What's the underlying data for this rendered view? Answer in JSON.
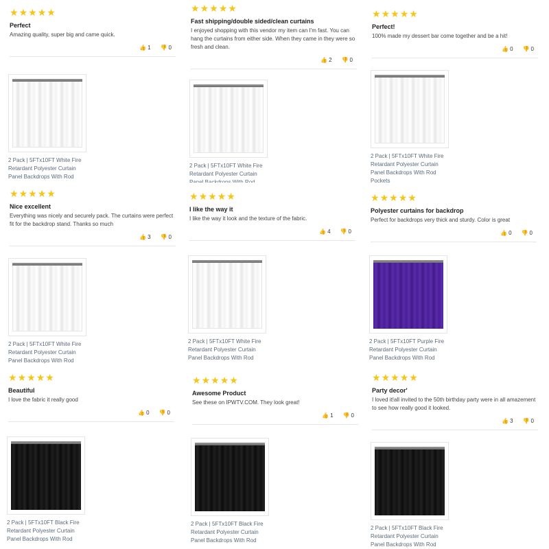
{
  "reviews": [
    {
      "title": "Perfect",
      "body": "Amazing quality, super big and came quick.",
      "up": "1",
      "down": "0",
      "product": {
        "color": "white",
        "name": "2 Pack | 5FTx10FT White Fire Retardant Polyester Curtain Panel Backdrops With Rod"
      }
    },
    {
      "title": "Fast shipping/double sided/clean curtains",
      "body": "I enjoyed shopping with this vendor my item can I'm fast. You can hang the curtains from either side. When they came in they were so fresh and clean.",
      "up": "2",
      "down": "0",
      "product": {
        "color": "white",
        "name": "2 Pack | 5FTx10FT White Fire Retardant Polyester Curtain Panel Backdrops With Rod"
      }
    },
    {
      "title": "Perfect!",
      "body": "100% made my dessert bar come together and be a hit!",
      "up": "0",
      "down": "0",
      "product": {
        "color": "white",
        "name": "2 Pack | 5FTx10FT White Fire Retardant Polyester Curtain Panel Backdrops With Rod Pockets"
      }
    },
    {
      "title": "Nice excellent",
      "body": "Everything was nicely and securely pack. The curtains were perfect fit for the backdrop stand. Thanks so much",
      "up": "3",
      "down": "0",
      "product": {
        "color": "white",
        "name": "2 Pack | 5FTx10FT White Fire Retardant Polyester Curtain Panel Backdrops With Rod"
      }
    },
    {
      "title": "I like the way it",
      "body": "I like the way it look and the texture of the fabric.",
      "up": "4",
      "down": "0",
      "product": {
        "color": "white",
        "name": "2 Pack | 5FTx10FT White Fire Retardant Polyester Curtain Panel Backdrops With Rod"
      }
    },
    {
      "title": "Polyester curtains for backdrop",
      "body": "Perfect for backdrops very thick and sturdy. Color is great",
      "up": "0",
      "down": "0",
      "product": {
        "color": "purple",
        "name": "2 Pack | 5FTx10FT Purple Fire Retardant Polyester Curtain Panel Backdrops With Rod"
      }
    },
    {
      "title": "Beautiful",
      "body": "I love the fabric it really good",
      "up": "0",
      "down": "0",
      "product": {
        "color": "black",
        "name": "2 Pack | 5FTx10FT Black Fire Retardant Polyester Curtain Panel Backdrops With Rod"
      }
    },
    {
      "title": "Awesome Product",
      "body": "See these on IPWTV.COM. They look great!",
      "up": "1",
      "down": "0",
      "product": {
        "color": "black",
        "name": "2 Pack | 5FTx10FT Black Fire Retardant Polyester Curtain Panel Backdrops With Rod"
      }
    },
    {
      "title": "Party decor'",
      "body": "I loved it!all invited to the 50th birthday party were in all amazement to see how really good it looked.",
      "up": "3",
      "down": "0",
      "product": {
        "color": "black",
        "name": "2 Pack | 5FTx10FT Black Fire Retardant Polyester Curtain Panel Backdrops With Rod"
      }
    }
  ],
  "star_count": 5,
  "icons": {
    "star": "star-icon",
    "thumb_up": "thumbs-up-icon",
    "thumb_down": "thumbs-down-icon"
  },
  "colors": {
    "star": "#f5c518",
    "product_link": "#5b6b7b"
  }
}
